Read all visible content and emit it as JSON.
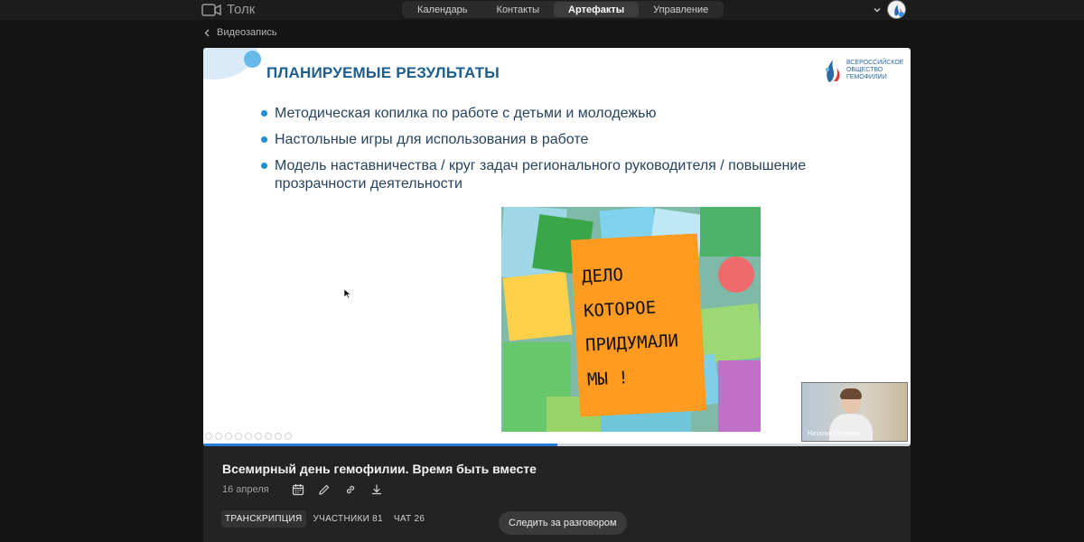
{
  "app": {
    "name": "Толк"
  },
  "nav": {
    "tabs": [
      {
        "label": "Календарь"
      },
      {
        "label": "Контакты"
      },
      {
        "label": "Артефакты"
      },
      {
        "label": "Управление"
      }
    ]
  },
  "breadcrumb": {
    "back_label": "Видеозапись"
  },
  "slide": {
    "title": "ПЛАНИРУЕМЫЕ РЕЗУЛЬТАТЫ",
    "org_name_lines": [
      "ВСЕРОССИЙСКОЕ",
      "ОБЩЕСТВО",
      "ГЕМОФИЛИИ"
    ],
    "bullets": [
      "Методическая копилка по работе с детьми и молодежью",
      "Настольные игры для использования в работе",
      "Модель наставничества / круг задач регионального руководителя / повышение прозрачности деятельности"
    ],
    "sticky_note_lines": [
      "ДЕЛО",
      "КОТОРОЕ",
      "ПРИДУМАЛИ",
      "МЫ !"
    ]
  },
  "speaker": {
    "name": "Наталия Полищук"
  },
  "player": {
    "progress_fraction": 0.5
  },
  "recording": {
    "title": "Всемирный день гемофилии. Время быть вместе",
    "date": "16 апреля"
  },
  "tabs": {
    "transcript": "ТРАНСКРИПЦИЯ",
    "participants": "УЧАСТНИКИ 81",
    "chat": "ЧАТ 26"
  },
  "follow_button": "Следить за разговором",
  "colors": {
    "accent": "#2a7bd6",
    "slide_title": "#1c5e8f",
    "sticky": "#ff9b21"
  }
}
